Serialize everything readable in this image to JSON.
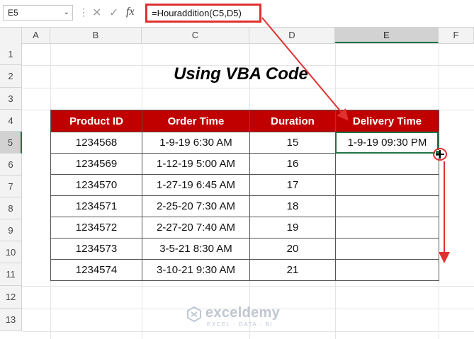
{
  "formula_bar": {
    "name_box": "E5",
    "formula": "=Houraddition(C5,D5)",
    "fx_label": "fx"
  },
  "columns": [
    "A",
    "B",
    "C",
    "D",
    "E",
    "F"
  ],
  "rows": [
    "1",
    "2",
    "3",
    "4",
    "5",
    "6",
    "7",
    "8",
    "9",
    "10",
    "11",
    "12",
    "13"
  ],
  "selected": {
    "column": "E",
    "row": "5"
  },
  "sheet": {
    "title": "Using VBA Code",
    "headers": [
      "Product ID",
      "Order Time",
      "Duration",
      "Delivery Time"
    ],
    "rows": [
      [
        "1234568",
        "1-9-19 6:30 AM",
        "15",
        "1-9-19 09:30 PM"
      ],
      [
        "1234569",
        "1-12-19 5:00 AM",
        "16",
        ""
      ],
      [
        "1234570",
        "1-27-19 6:45 AM",
        "17",
        ""
      ],
      [
        "1234571",
        "2-25-20 7:30 AM",
        "18",
        ""
      ],
      [
        "1234572",
        "2-27-20 7:40 AM",
        "19",
        ""
      ],
      [
        "1234573",
        "3-5-21 8:30 AM",
        "20",
        ""
      ],
      [
        "1234574",
        "3-10-21 9:30 AM",
        "21",
        ""
      ]
    ]
  },
  "colors": {
    "header_fill": "#c00000",
    "header_text": "#ffffff",
    "selection": "#217346",
    "annotation": "#e03030"
  },
  "watermark": {
    "name": "exceldemy",
    "tagline": "EXCEL · DATA · BI"
  }
}
